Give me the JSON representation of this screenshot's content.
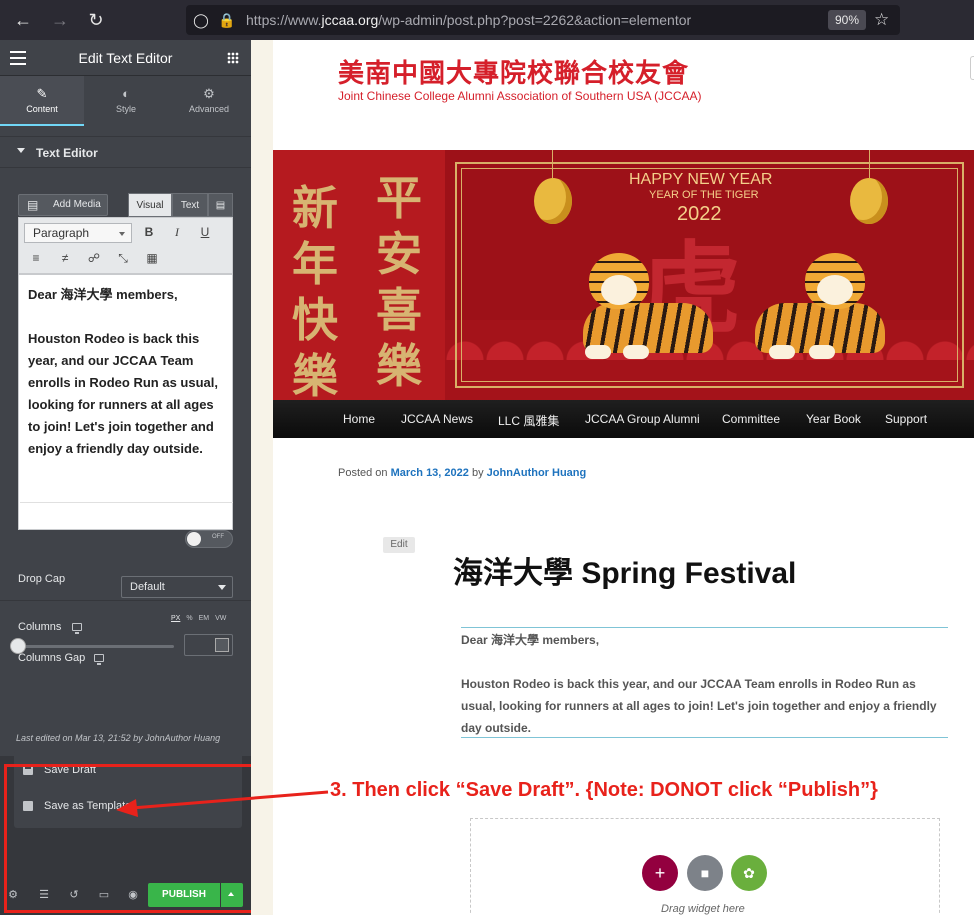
{
  "browser": {
    "url_prefix": "https://www.",
    "url_domain": "jccaa.org",
    "url_path": "/wp-admin/post.php?post=2262&action=elementor",
    "zoom": "90%"
  },
  "panel": {
    "title": "Edit Text Editor",
    "tabs": [
      {
        "label": "Content",
        "icon": "pencil-icon"
      },
      {
        "label": "Style",
        "icon": "half-circle-icon"
      },
      {
        "label": "Advanced",
        "icon": "gear-icon"
      }
    ],
    "section_title": "Text Editor",
    "add_media": "Add Media",
    "visual_tab": "Visual",
    "text_tab": "Text",
    "paragraph_select": "Paragraph",
    "toolbar_bold": "B",
    "toolbar_italic": "I",
    "toolbar_underline": "U",
    "editor_paragraphs": [
      "Dear 海洋大學 members,",
      "Houston Rodeo is back this year, and our JCCAA Team enrolls in Rodeo Run as usual, looking for runners at all ages to join! Let's join together and enjoy a friendly day outside."
    ],
    "drop_cap_label": "Drop Cap",
    "toggle_off": "OFF",
    "columns_label": "Columns",
    "columns_value": "Default",
    "columns_gap_label": "Columns Gap",
    "units": [
      "PX",
      "%",
      "EM",
      "VW"
    ],
    "last_edited": "Last edited on Mar 13, 21:52 by JohnAuthor Huang",
    "save_draft": "Save Draft",
    "save_template": "Save as Template",
    "publish": "PUBLISH"
  },
  "site": {
    "title": "美南中國大專院校聯合校友會",
    "tagline": "Joint Chinese College Alumni Association of Southern USA (JCCAA)",
    "banner": {
      "couplet_left": "新年快樂",
      "couplet_right": "平安喜樂",
      "line1": "HAPPY NEW YEAR",
      "line2": "YEAR OF THE TIGER",
      "line3": "2022",
      "center_char": "虎"
    },
    "menu": [
      "Home",
      "JCCAA News",
      "LLC 風雅集",
      "JCCAA Group Alumni",
      "Committee",
      "Year Book",
      "Support"
    ],
    "posted_on": "Posted on",
    "post_date": "March 13, 2022",
    "by": "by",
    "author": "JohnAuthor Huang",
    "edit": "Edit",
    "post_title": "海洋大學 Spring Festival",
    "content_paragraphs": [
      "Dear 海洋大學 members,",
      "Houston Rodeo is back this year, and our JCCAA Team enrolls in Rodeo Run as usual, looking for runners at all ages to join! Let's join together and enjoy a friendly day outside."
    ],
    "drag_widget": "Drag widget here"
  },
  "annotation": "3. Then click “Save Draft”.  {Note: DONOT click “Publish”}",
  "colors": {
    "accent_red": "#e8221b",
    "site_red": "#d51f2a",
    "publish_green": "#39b54a",
    "elementor_panel": "#404349",
    "link_blue": "#1e73be"
  }
}
